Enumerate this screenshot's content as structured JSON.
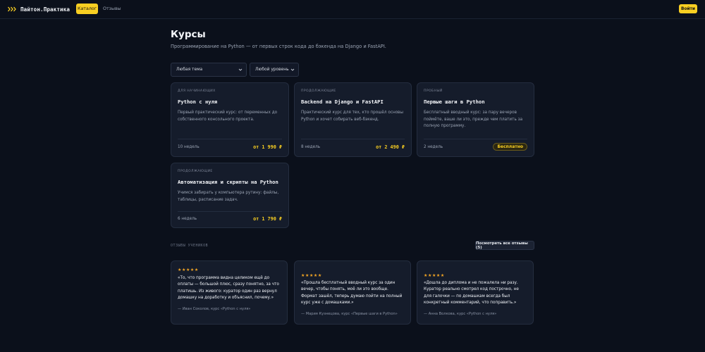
{
  "header": {
    "logo_text": "Пайтон.Практика",
    "nav": {
      "catalog": "Каталог",
      "reviews": "Отзывы"
    },
    "login": "Войти",
    "accent_color": "#f9cf22"
  },
  "page": {
    "title": "Курсы",
    "subtitle": "Программирование на Python — от первых строк кода до бэкенда на Django и FastAPI."
  },
  "filters": {
    "topic": "Любая тема",
    "level": "Любой уровень"
  },
  "courses": [
    {
      "tag": "для начинающих",
      "title": "Python с нуля",
      "description": "Первый практический курс: от переменных до собственного консольного проекта.",
      "duration": "10 недель",
      "price": "от 1 990 ₽"
    },
    {
      "tag": "продолжающие",
      "title": "Backend на Django и FastAPI",
      "description": "Практический курс для тех, кто прошёл основы Python и хочет собирать веб-бэкенд.",
      "duration": "8 недель",
      "price": "от 2 490 ₽"
    },
    {
      "tag": "пробный",
      "title": "Первые шаги в Python",
      "description": "Бесплатный вводный курс: за пару вечеров поймёте, ваше ли это, прежде чем платить за полную программу.",
      "duration": "2 недель",
      "price": "Бесплатно"
    },
    {
      "tag": "продолжающие",
      "title": "Автоматизация и скрипты на Python",
      "description": "Учимся забирать у компьютера рутину: файлы, таблицы, расписание задач.",
      "duration": "6 недель",
      "price": "от 1 790 ₽"
    }
  ],
  "reviews": {
    "section_label": "отзывы учеников",
    "view_all": "Посмотреть все отзывы (5)",
    "items": [
      {
        "stars": "★★★★★",
        "rating": 5,
        "text": "«То, что программа видна целиком ещё до оплаты — большой плюс, сразу понятно, за что платишь. Из живого: куратор один раз вернул домашку на доработку и объяснил, почему.»",
        "author": "— Иван Соколов, курс «Python с нуля»"
      },
      {
        "stars": "★★★★★",
        "rating": 5,
        "text": "«Прошла бесплатный вводный курс за один вечер, чтобы понять, моё ли это вообще. Формат зашёл, теперь думаю пойти на полный курс уже с домашками.»",
        "author": "— Мария Кузнецова, курс «Первые шаги в Python»"
      },
      {
        "stars": "★★★★★",
        "rating": 5,
        "text": "«Дошла до диплома и не пожалела ни разу. Куратор реально смотрел код построчно, не для галочки — по домашкам всегда был конкретный комментарий, что поправить.»",
        "author": "— Анна Волкова, курс «Python с нуля»"
      }
    ]
  }
}
